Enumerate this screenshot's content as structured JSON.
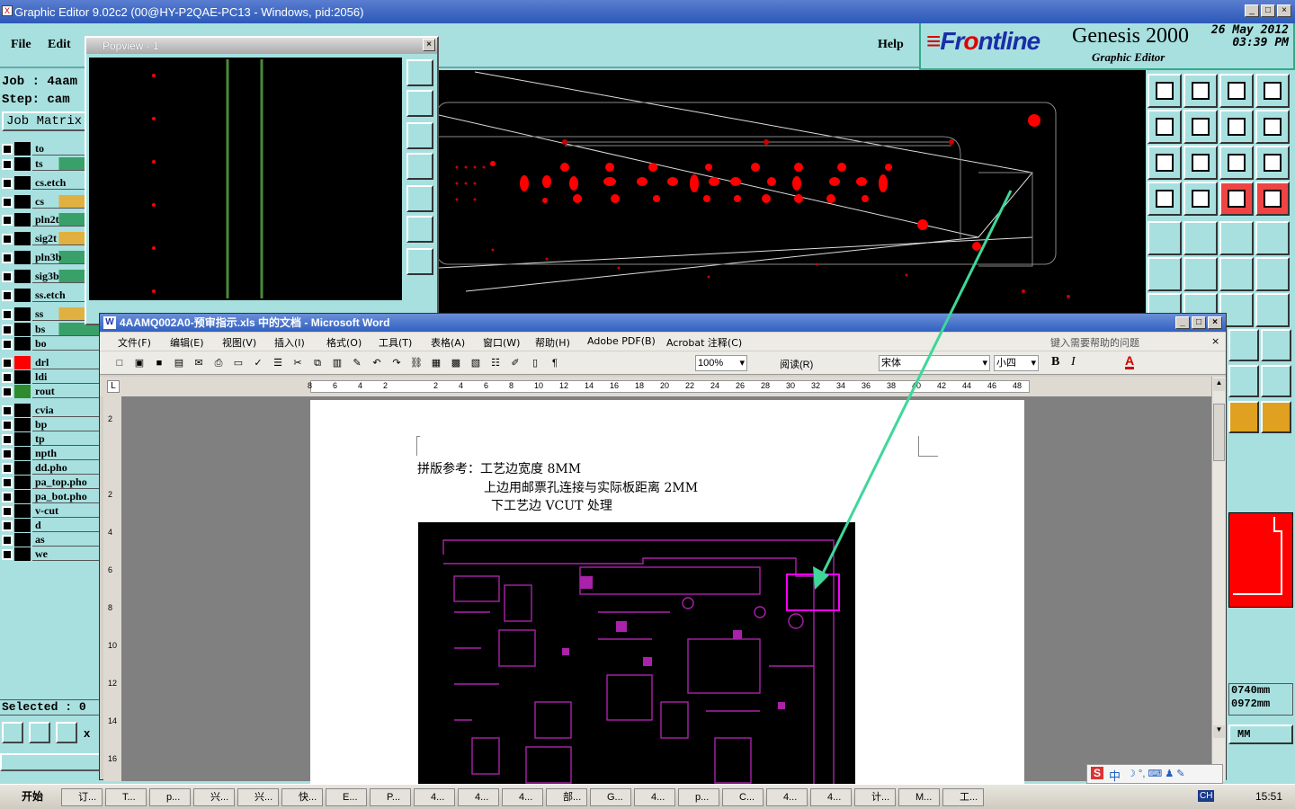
{
  "graphic_editor": {
    "title": "Graphic Editor 9.02c2 (00@HY-P2QAE-PC13 - Windows, pid:2056)",
    "menu": {
      "file": "File",
      "edit": "Edit",
      "help": "Help"
    },
    "brand": {
      "logo_main": "Fr",
      "logo_o": "o",
      "logo_rest": "ntline",
      "product": "Genesis 2000",
      "subtitle": "Graphic Editor"
    },
    "date": "26 May 2012",
    "time": "03:39 PM",
    "job_label": "Job : 4aam",
    "step_label": "Step: cam",
    "job_matrix": "Job Matrix",
    "selected": "Selected : 0",
    "coords": {
      "x": "0740mm",
      "y": "0972mm"
    },
    "units": "MM",
    "layers": [
      {
        "name": "to",
        "color": "#000000"
      },
      {
        "name": "ts",
        "color": "#000000"
      },
      {
        "name": "cs.etch",
        "color": "#000000"
      },
      {
        "name": "cs",
        "color": "#000000"
      },
      {
        "name": "pln2t",
        "color": "#000000"
      },
      {
        "name": "sig2t",
        "color": "#000000"
      },
      {
        "name": "pln3b",
        "color": "#000000"
      },
      {
        "name": "sig3b",
        "color": "#000000"
      },
      {
        "name": "ss.etch",
        "color": "#000000"
      },
      {
        "name": "ss",
        "color": "#000000"
      },
      {
        "name": "bs",
        "color": "#000000"
      },
      {
        "name": "bo",
        "color": "#000000"
      },
      {
        "name": "drl",
        "color": "#ff0000"
      },
      {
        "name": "ldi",
        "color": "#000000"
      },
      {
        "name": "rout",
        "color": "#2e8b2e"
      },
      {
        "name": "cvia",
        "color": "#000000"
      },
      {
        "name": "bp",
        "color": "#000000"
      },
      {
        "name": "tp",
        "color": "#000000"
      },
      {
        "name": "npth",
        "color": "#000000"
      },
      {
        "name": "dd.pho",
        "color": "#000000"
      },
      {
        "name": "pa_top.pho",
        "color": "#000000"
      },
      {
        "name": "pa_bot.pho",
        "color": "#000000"
      },
      {
        "name": "v-cut",
        "color": "#000000"
      },
      {
        "name": "d",
        "color": "#000000"
      },
      {
        "name": "as",
        "color": "#000000"
      },
      {
        "name": "we",
        "color": "#000000"
      }
    ]
  },
  "popview": {
    "title": "Popview - 1"
  },
  "word": {
    "title": "4AAMQ002A0-预审指示.xls 中的文档 - Microsoft Word",
    "menu": [
      "文件(F)",
      "编辑(E)",
      "视图(V)",
      "插入(I)",
      "格式(O)",
      "工具(T)",
      "表格(A)",
      "窗口(W)",
      "帮助(H)",
      "Adobe PDF(B)",
      "Acrobat 注释(C)"
    ],
    "help_prompt": "键入需要帮助的问题",
    "zoom": "100%",
    "read_mode": "阅读(R)",
    "font": "宋体",
    "font_size": "小四",
    "bold": "B",
    "italic": "I",
    "font_color": "A",
    "ruler_numbers": [
      "8",
      "6",
      "4",
      "2",
      "",
      "2",
      "4",
      "6",
      "8",
      "10",
      "12",
      "14",
      "16",
      "18",
      "20",
      "22",
      "24",
      "26",
      "28",
      "30",
      "32",
      "34",
      "36",
      "38",
      "40",
      "42",
      "44",
      "46",
      "48"
    ],
    "vruler_numbers": [
      "2",
      "",
      "2",
      "4",
      "6",
      "8",
      "10",
      "12",
      "14",
      "16"
    ],
    "doc_lines": [
      "拼版参考：工艺边宽度 8MM",
      "上边用邮票孔连接与实际板距离 2MM",
      "下工艺边 VCUT 处理"
    ]
  },
  "ime": {
    "mode": "中"
  },
  "taskbar": {
    "start": "开始",
    "items": [
      "订...",
      "T...",
      "p...",
      "兴...",
      "兴...",
      "快...",
      "E...",
      "P...",
      "4...",
      "4...",
      "4...",
      "部...",
      "G...",
      "4...",
      "p...",
      "C...",
      "4...",
      "4...",
      "计...",
      "M...",
      "工..."
    ],
    "tray_lang": "CH",
    "clock": "15:51"
  },
  "colors": {
    "accent": "#a8e0e0",
    "pcb_drill": "#ff0000",
    "pcb_outline": "#aa22aa",
    "annotation": "#3fd79a"
  }
}
